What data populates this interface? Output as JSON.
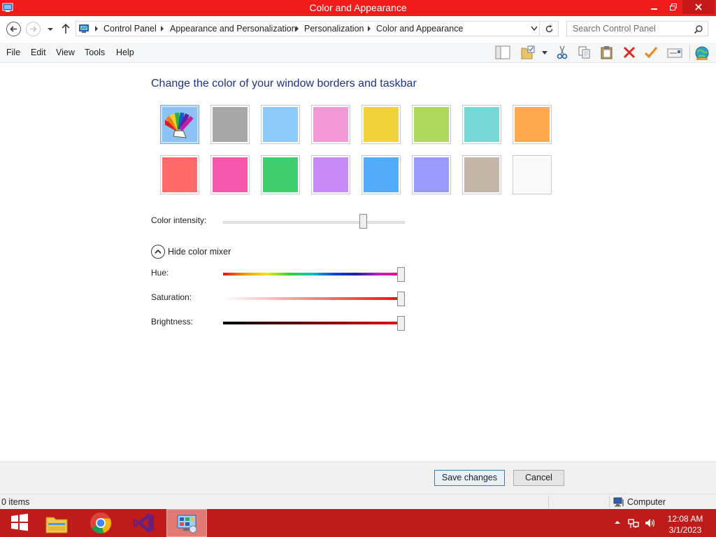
{
  "window": {
    "title": "Color and Appearance"
  },
  "address_bar": {
    "breadcrumbs": [
      "Control Panel",
      "Appearance and Personalization",
      "Personalization",
      "Color and Appearance"
    ],
    "search_placeholder": "Search Control Panel"
  },
  "menu": {
    "items": [
      "File",
      "Edit",
      "View",
      "Tools",
      "Help"
    ]
  },
  "toolbar": {
    "icons": [
      "layout-pane-icon",
      "folder-options-icon",
      "cut-icon",
      "copy-icon",
      "paste-icon",
      "delete-icon",
      "properties-check-icon",
      "email-icon",
      "internet-globe-icon"
    ]
  },
  "main": {
    "heading": "Change the color of your window borders and taskbar",
    "swatches": [
      {
        "name": "automatic",
        "color": "#8dc2f4",
        "selected": true
      },
      {
        "name": "sky",
        "color": "#a8a8a8"
      },
      {
        "name": "twilight",
        "color": "#8ecbfa"
      },
      {
        "name": "blush",
        "color": "#f19ad6"
      },
      {
        "name": "gold",
        "color": "#f0d33a"
      },
      {
        "name": "leaf",
        "color": "#acd95c"
      },
      {
        "name": "sea-foam",
        "color": "#78d8d6"
      },
      {
        "name": "orange",
        "color": "#ffa84d"
      },
      {
        "name": "red",
        "color": "#fd6a6a"
      },
      {
        "name": "pink",
        "color": "#f458ad"
      },
      {
        "name": "green",
        "color": "#3fcf70"
      },
      {
        "name": "lavender",
        "color": "#c88bf6"
      },
      {
        "name": "blue",
        "color": "#54acfb"
      },
      {
        "name": "violet",
        "color": "#9a9af8"
      },
      {
        "name": "taupe",
        "color": "#c3b6a9"
      },
      {
        "name": "frost",
        "color": "#fafafa"
      }
    ],
    "intensity_label": "Color intensity:",
    "intensity_value": 0.86,
    "mixer_toggle_label": "Hide color mixer",
    "hue_label": "Hue:",
    "hue_value": 1.0,
    "saturation_label": "Saturation:",
    "saturation_value": 1.0,
    "brightness_label": "Brightness:",
    "brightness_value": 1.0
  },
  "buttons": {
    "save": "Save changes",
    "cancel": "Cancel"
  },
  "status": {
    "items": "0 items",
    "location": "Computer"
  },
  "taskbar": {
    "apps": [
      "start-button",
      "file-explorer",
      "chrome",
      "visual-studio",
      "control-panel"
    ],
    "time": "12:08 AM",
    "date": "3/1/2023"
  },
  "colors": {
    "titlebar": "#f01c1c",
    "taskbar": "#bf1b1b",
    "heading": "#1e3287"
  }
}
